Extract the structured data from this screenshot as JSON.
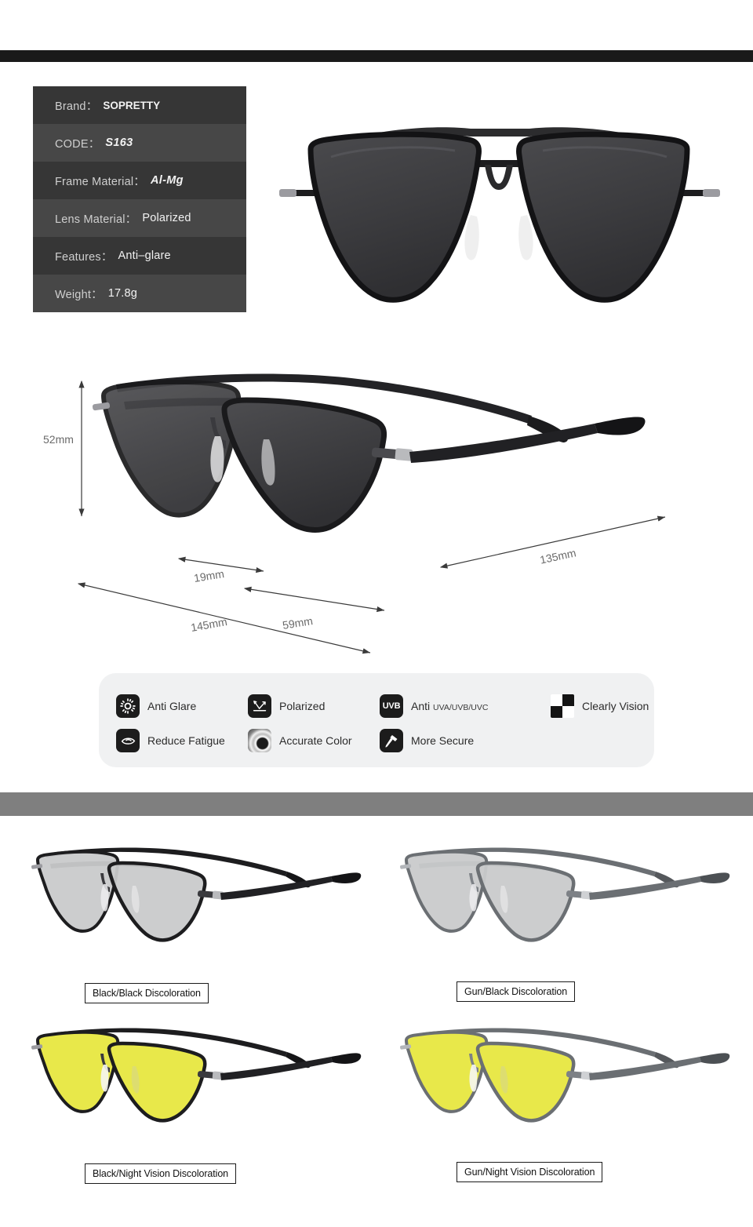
{
  "colors": {
    "top_bar": "#1a1a1a",
    "divider_band": "#7f7f7f",
    "spec_row_dark": "#363636",
    "spec_row_light": "#474747",
    "features_panel": "#f0f1f2",
    "icon_tile": "#1c1c1c",
    "lens_dark": "#3a3a3c",
    "lens_light": "#c9cacb",
    "lens_yellow": "#e8e84a",
    "frame_black": "#1d1d1f",
    "frame_gun": "#6b6f73",
    "dimension_text": "#6a6a6a"
  },
  "spec_table": {
    "rows": [
      {
        "key": "Brand：",
        "value": "SOPRETTY",
        "style": "semi"
      },
      {
        "key": "CODE：",
        "value": "S163",
        "style": "bold"
      },
      {
        "key": "Frame Material：",
        "value": "Al-Mg",
        "style": "bold"
      },
      {
        "key": "Lens Material：",
        "value": "Polarized",
        "style": "plain"
      },
      {
        "key": "Features：",
        "value": "Anti–glare",
        "style": "plain"
      },
      {
        "key": "Weight：",
        "value": "17.8g",
        "style": "plain"
      }
    ]
  },
  "dimensions": {
    "lens_height": "52mm",
    "bridge": "19mm",
    "lens_width": "59mm",
    "frame_width": "145mm",
    "temple_length": "135mm"
  },
  "features": {
    "items": [
      {
        "label": "Anti Glare",
        "sub": "",
        "icon": "sun-icon"
      },
      {
        "label": "Polarized",
        "sub": "",
        "icon": "polarized-arrows-icon"
      },
      {
        "label": "Anti ",
        "sub": "UVA/UVB/UVC",
        "icon": "uvb-badge-icon"
      },
      {
        "label": "Clearly Vision",
        "sub": "",
        "icon": "checkerboard-icon"
      },
      {
        "label": "Reduce Fatigue",
        "sub": "",
        "icon": "eye-icon"
      },
      {
        "label": "Accurate Color",
        "sub": "",
        "icon": "color-ring-icon"
      },
      {
        "label": "More Secure",
        "sub": "",
        "icon": "hammer-icon"
      }
    ]
  },
  "variants": [
    {
      "label": "Black/Black Discoloration",
      "frame": "#1d1d1f",
      "lens": "#c9cacb",
      "lens_opacity": 0.95
    },
    {
      "label": "Gun/Black Discoloration",
      "frame": "#6b6f73",
      "lens": "#c9cacb",
      "lens_opacity": 0.95
    },
    {
      "label": "Black/Night Vision Discoloration",
      "frame": "#1d1d1f",
      "lens": "#e8e84a",
      "lens_opacity": 1
    },
    {
      "label": "Gun/Night Vision Discoloration",
      "frame": "#6b6f73",
      "lens": "#e8e84a",
      "lens_opacity": 1
    }
  ]
}
